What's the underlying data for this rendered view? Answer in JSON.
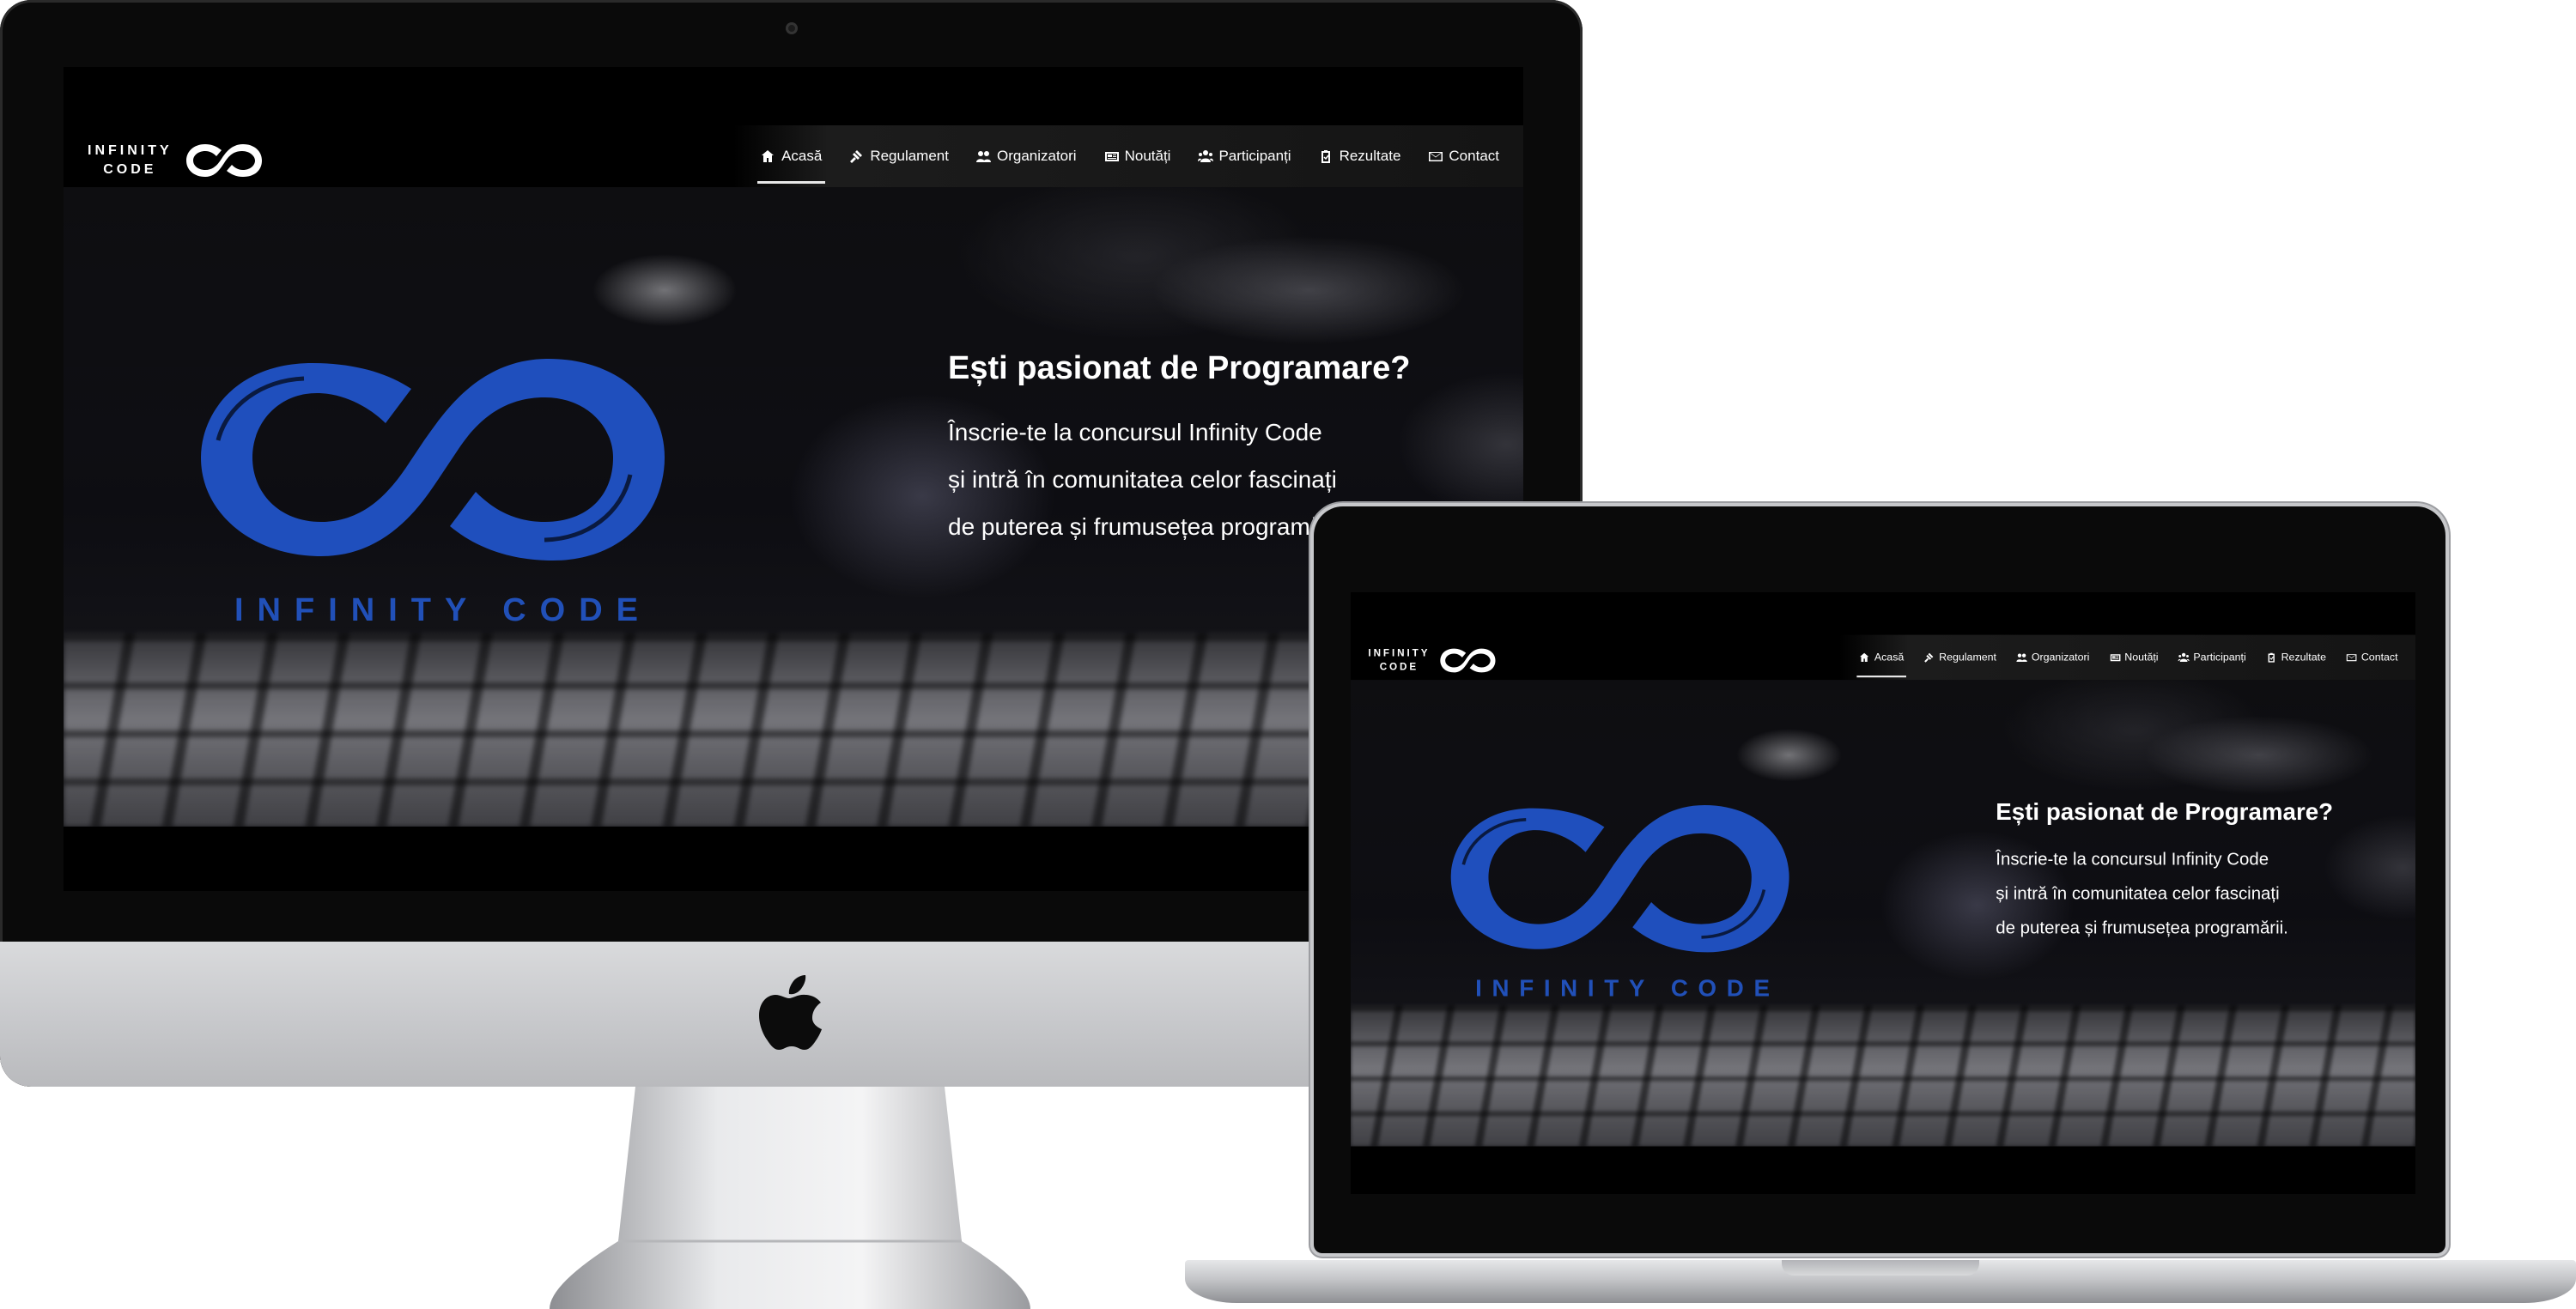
{
  "site": {
    "brand": {
      "line1": "INFINITY",
      "line2": "CODE"
    },
    "nav": [
      {
        "label": "Acasă",
        "icon": "home-icon",
        "active": true
      },
      {
        "label": "Regulament",
        "icon": "gavel-icon",
        "active": false
      },
      {
        "label": "Organizatori",
        "icon": "users-icon",
        "active": false
      },
      {
        "label": "Noutăți",
        "icon": "newspaper-icon",
        "active": false
      },
      {
        "label": "Participanți",
        "icon": "group-icon",
        "active": false
      },
      {
        "label": "Rezultate",
        "icon": "clipboard-check-icon",
        "active": false
      },
      {
        "label": "Contact",
        "icon": "envelope-icon",
        "active": false
      }
    ],
    "hero": {
      "title": "Ești pasionat de Programare?",
      "line1": "Înscrie-te la concursul Infinity Code",
      "line2": "și intră în comunitatea celor fascinați",
      "line3": "de puterea și frumusețea programării.",
      "logo_text": "INFINITY CODE"
    }
  },
  "colors": {
    "accent_blue": "#2150b8",
    "nav_bg": "#141414",
    "text": "#ffffff"
  }
}
